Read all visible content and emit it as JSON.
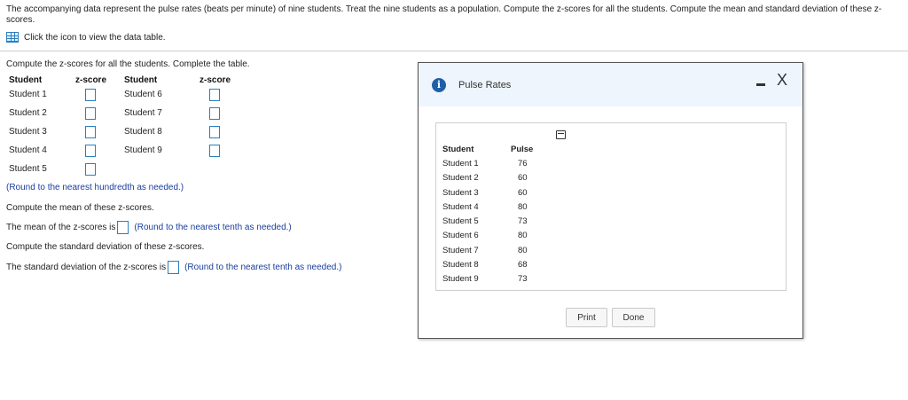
{
  "prompt": "The accompanying data represent the pulse rates (beats per minute) of nine students. Treat the nine students as a population. Compute the z-scores for all the students. Compute the mean and standard deviation of these z-scores.",
  "data_link": {
    "icon": "table-icon",
    "label": "Click the icon to view the data table."
  },
  "part_a": {
    "instruction": "Compute the z-scores for all the students. Complete the table.",
    "headers": {
      "student1": "Student",
      "zscore1": "z-score",
      "student2": "Student",
      "zscore2": "z-score"
    },
    "left_students": [
      "Student 1",
      "Student 2",
      "Student 3",
      "Student 4",
      "Student 5"
    ],
    "right_students": [
      "Student 6",
      "Student 7",
      "Student 8",
      "Student 9"
    ],
    "round_note": "(Round to the nearest hundredth as needed.)"
  },
  "part_b": {
    "instruction": "Compute the mean of these z-scores.",
    "answer_prefix": "The mean of the z-scores is",
    "round_note": "(Round to the nearest tenth as needed.)"
  },
  "part_c": {
    "instruction": "Compute the standard deviation of these z-scores.",
    "answer_prefix": "The standard deviation of the z-scores is",
    "round_note": "(Round to the nearest tenth as needed.)"
  },
  "dialog": {
    "title": "Pulse Rates",
    "minimize": "-",
    "close": "X",
    "table": {
      "headers": [
        "Student",
        "Pulse"
      ],
      "rows": [
        [
          "Student 1",
          "76"
        ],
        [
          "Student 2",
          "60"
        ],
        [
          "Student 3",
          "60"
        ],
        [
          "Student 4",
          "80"
        ],
        [
          "Student 5",
          "73"
        ],
        [
          "Student 6",
          "80"
        ],
        [
          "Student 7",
          "80"
        ],
        [
          "Student 8",
          "68"
        ],
        [
          "Student 9",
          "73"
        ]
      ]
    },
    "buttons": {
      "print": "Print",
      "done": "Done"
    }
  }
}
